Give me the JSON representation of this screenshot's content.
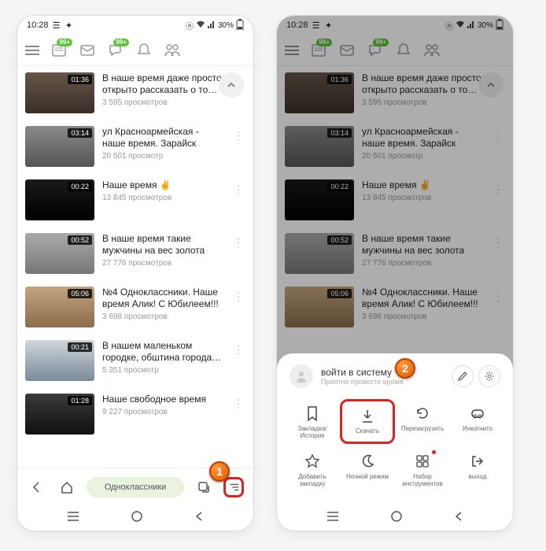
{
  "status": {
    "time": "10:28",
    "battery": "30%",
    "badge": "99+"
  },
  "videos": [
    {
      "duration": "01:36",
      "title": "В наше время даже просто открыто рассказать о том, что…",
      "views": "3 595 просмотров",
      "thumb": "th1"
    },
    {
      "duration": "03:14",
      "title": "ул Красноармейская - наше время. Зарайск",
      "views": "20 501 просмотр",
      "thumb": "th2"
    },
    {
      "duration": "00:22",
      "title": "Наше время ✌️",
      "views": "13 845 просмотров",
      "thumb": "th3"
    },
    {
      "duration": "00:52",
      "title": "В наше время такие мужчины на вес золота",
      "views": "27 776 просмотров",
      "thumb": "th4"
    },
    {
      "duration": "05:06",
      "title": "№4 Одноклассники. Наше время Алик! С Юбилеем!!!",
      "views": "3 698 просмотров",
      "thumb": "th5"
    },
    {
      "duration": "00:21",
      "title": "В нашем маленьком городке, обштина города Бар установила…",
      "views": "5 351 просмотр",
      "thumb": "th6"
    },
    {
      "duration": "01:28",
      "title": "Наше свободное время",
      "views": "9 227 просмотров",
      "thumb": "th7"
    }
  ],
  "browser": {
    "site": "Одноклассники"
  },
  "sheet": {
    "login": "войти в систему",
    "subtitle": "Приятно провести время",
    "row1": [
      {
        "label": "Закладка/История",
        "icon": "bookmark"
      },
      {
        "label": "Скачать",
        "icon": "download",
        "hl": true
      },
      {
        "label": "Перезагрузить",
        "icon": "reload"
      },
      {
        "label": "Инкогнито",
        "icon": "incognito"
      }
    ],
    "row2": [
      {
        "label": "Добавить закладку",
        "icon": "star"
      },
      {
        "label": "Ночной режим",
        "icon": "moon"
      },
      {
        "label": "Набор инструментов",
        "icon": "grid",
        "dot": true
      },
      {
        "label": "выход",
        "icon": "exit"
      }
    ]
  },
  "markers": {
    "one": "1",
    "two": "2"
  }
}
